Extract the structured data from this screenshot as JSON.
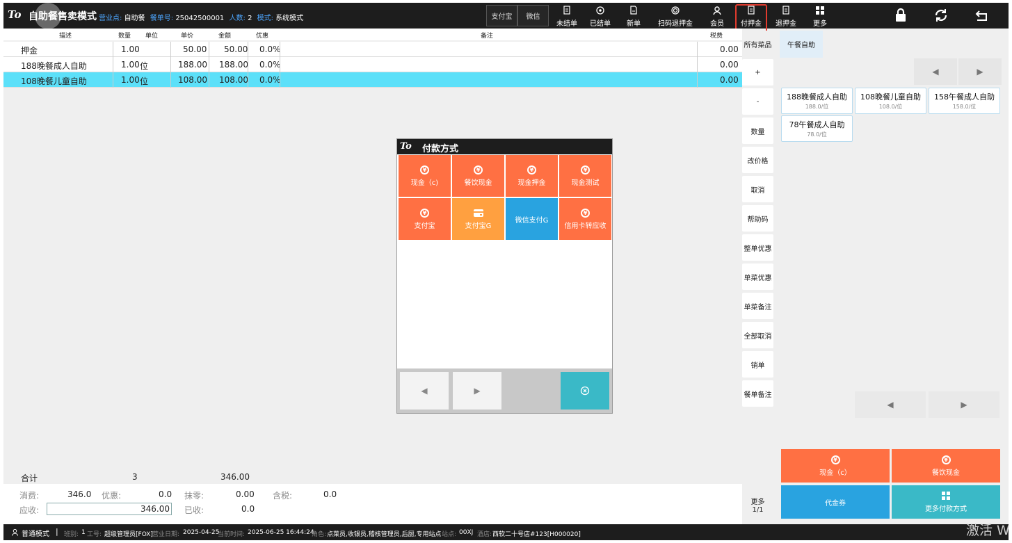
{
  "header": {
    "logo": "To",
    "title": "自助餐售卖模式",
    "business_point_label": "营业点:",
    "business_point": "自助餐",
    "order_no_label": "餐单号:",
    "order_no": "25042500001",
    "people_label": "人数:",
    "people": "2",
    "mode_label": "模式:",
    "mode": "系统模式",
    "pay_alipay": "支付宝",
    "pay_wechat": "微信",
    "buttons": [
      "未结单",
      "已结单",
      "新单",
      "扫码退押金",
      "会员",
      "付押金",
      "退押金",
      "更多"
    ]
  },
  "order_table": {
    "headers": {
      "desc": "描述",
      "qty": "数量",
      "unit": "单位",
      "price": "单价",
      "amount": "金额",
      "discount": "优惠",
      "remark": "备注",
      "tax": "税费"
    },
    "rows": [
      {
        "desc": "押金",
        "qty": "1.00",
        "unit": "",
        "price": "50.00",
        "amount": "50.00",
        "discount": "0.0%",
        "tax": "0.00",
        "selected": false
      },
      {
        "desc": "188晚餐成人自助",
        "qty": "1.00",
        "unit": "位",
        "price": "188.00",
        "amount": "188.00",
        "discount": "0.0%",
        "tax": "0.00",
        "selected": false
      },
      {
        "desc": "108晚餐儿童自助",
        "qty": "1.00",
        "unit": "位",
        "price": "108.00",
        "amount": "108.00",
        "discount": "0.0%",
        "tax": "0.00",
        "selected": true
      }
    ]
  },
  "totals": {
    "label": "合计",
    "qty": "3",
    "amount": "346.00"
  },
  "summary": {
    "consume_label": "消费:",
    "consume": "346.0",
    "discount_label": "优惠:",
    "discount": "0.0",
    "rounding_label": "抹零:",
    "rounding": "0.00",
    "tax_label": "含税:",
    "tax": "0.0",
    "receivable_label": "应收:",
    "receivable": "346.00",
    "received_label": "已收:",
    "received": "0.0"
  },
  "ops": [
    "+",
    "-",
    "数量",
    "改价格",
    "取消",
    "帮助码",
    "整单优惠",
    "单菜优惠",
    "单菜备注",
    "全部取消",
    "销单",
    "餐单备注"
  ],
  "more_page": {
    "label": "更多",
    "page": "1/1"
  },
  "category": {
    "all": "所有菜品",
    "tab": "午餐自助"
  },
  "products": [
    {
      "name": "188晚餐成人自助",
      "price": "188.0/位"
    },
    {
      "name": "108晚餐儿童自助",
      "price": "108.0/位"
    },
    {
      "name": "158午餐成人自助",
      "price": "158.0/位"
    },
    {
      "name": "78午餐成人自助",
      "price": "78.0/位"
    }
  ],
  "quick_pay": {
    "cash": "现金（c）",
    "canyin_cash": "餐饮现金",
    "voucher": "代金券",
    "more_pay": "更多付款方式"
  },
  "dialog": {
    "logo": "To",
    "title": "付款方式",
    "methods": [
      {
        "label": "现金（c)",
        "color": "#ff7043",
        "icon": "yen-coin-icon"
      },
      {
        "label": "餐饮现金",
        "color": "#ff7043",
        "icon": "yen-coin-icon"
      },
      {
        "label": "现金押金",
        "color": "#ff7043",
        "icon": "yen-coin-icon"
      },
      {
        "label": "现金测试",
        "color": "#ff7043",
        "icon": "yen-coin-icon"
      },
      {
        "label": "支付宝",
        "color": "#ff7043",
        "icon": "yen-coin-icon"
      },
      {
        "label": "支付宝G",
        "color": "#ffa040",
        "icon": "card-icon"
      },
      {
        "label": "微信支付G",
        "color": "#29a3e0",
        "icon": ""
      },
      {
        "label": "信用卡转应收",
        "color": "#ff7043",
        "icon": "yen-coin-icon"
      }
    ]
  },
  "statusbar": {
    "mode": "普通模式",
    "shift_label": "班别:",
    "shift": "1",
    "staff_label": "工号:",
    "staff": "超级管理员[FOX]",
    "bizdate_label": "营业日期:",
    "bizdate": "2025-04-25",
    "now_label": "当前时间:",
    "now": "2025-06-25 16:44:24",
    "role_label": "角色:",
    "role": "点菜员,收银员,稽核管理员,后厨,专用站点",
    "site_label": "站点:",
    "site": "00XJ",
    "hotel_label": "酒店:",
    "hotel": "西软二十号店#123[H000020]"
  },
  "watermark": "激活 W",
  "colors": {
    "accent": "#ff7043",
    "orange2": "#ffa040",
    "blue": "#29a3e0",
    "teal": "#3ab9c7",
    "selected_row": "#5ce0f9",
    "highlight": "#e23b2e"
  }
}
